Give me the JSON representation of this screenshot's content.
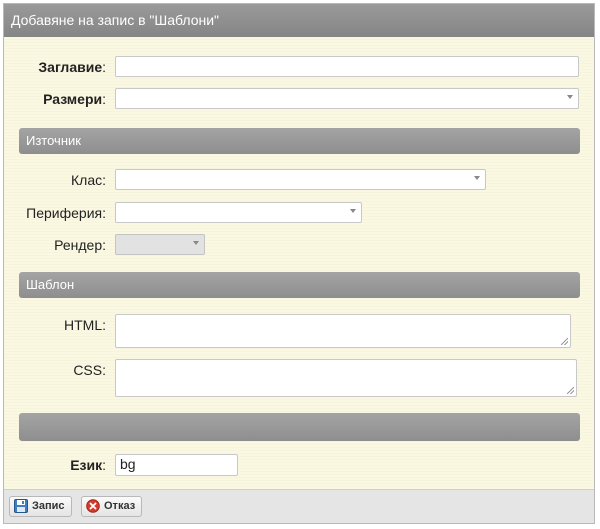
{
  "dialog": {
    "title": "Добавяне на запис в \"Шаблони\""
  },
  "fields": {
    "title_label": "Заглавие",
    "sizes_label": "Размери",
    "class_label": "Клас:",
    "periphery_label": "Периферия:",
    "render_label": "Рендер:",
    "html_label": "HTML:",
    "css_label": "CSS:",
    "language_label": "Език",
    "language_value": "bg",
    "colon": ":"
  },
  "sections": {
    "source": "Източник",
    "template": "Шаблон",
    "empty": ""
  },
  "footer": {
    "save_label": "Запис",
    "cancel_label": "Отказ"
  },
  "colors": {
    "background": "#fbf8e2",
    "section_bar": "#9a9a9a",
    "save_icon": "#3d7fc2",
    "cancel_icon": "#d23b2b"
  }
}
